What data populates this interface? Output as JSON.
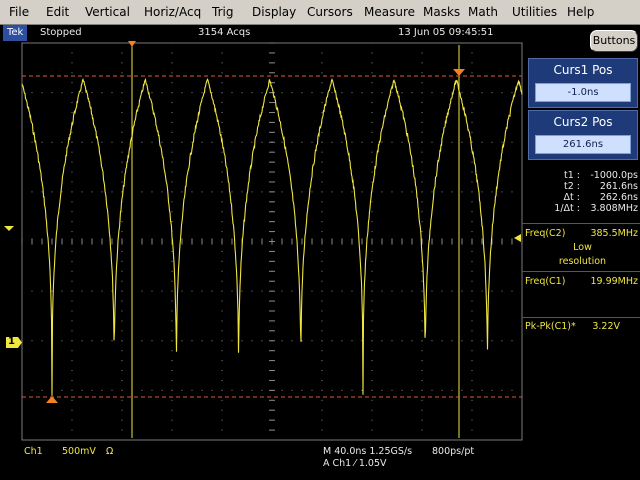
{
  "menu": [
    "File",
    "Edit",
    "Vertical",
    "Horiz/Acq",
    "Trig",
    "Display",
    "Cursors",
    "Measure",
    "Masks",
    "Math",
    "Utilities",
    "Help"
  ],
  "status": {
    "brand": "Tek",
    "state": "Stopped",
    "acqs": "3154 Acqs",
    "datetime": "13 Jun 05 09:45:51"
  },
  "buttons_label": "Buttons",
  "curs1": {
    "title": "Curs1 Pos",
    "value": "-1.0ns"
  },
  "curs2": {
    "title": "Curs2 Pos",
    "value": "261.6ns"
  },
  "cursor_readout": [
    {
      "label": "t1 :",
      "value": "-1000.0ps"
    },
    {
      "label": "t2 :",
      "value": "261.6ns"
    },
    {
      "label": "Δt :",
      "value": "262.6ns"
    },
    {
      "label": "1/Δt :",
      "value": "3.808MHz"
    }
  ],
  "measurements": {
    "freq_c2": {
      "name": "Freq(C2)",
      "value": "385.5MHz",
      "note1": "Low",
      "note2": "resolution"
    },
    "freq_c1": {
      "name": "Freq(C1)",
      "value": "19.99MHz"
    },
    "pkpk_c1": {
      "name": "Pk-Pk(C1)*",
      "value": "3.22V"
    }
  },
  "channel_marker": "1",
  "bottom": {
    "ch": "Ch1",
    "scale": "500mV",
    "ohm": "Ω",
    "timebase": "M 40.0ns 1.25GS/s",
    "resolution": "800ps/pt",
    "trigger": "A  Ch1  ⁄  1.05V"
  },
  "colors": {
    "trace": "#f0e642",
    "cursor_line": "#e05a2a",
    "grid": "#7a7a7a",
    "panel_blue": "#1f3a78",
    "menu_bg": "#d4d0c8"
  }
}
